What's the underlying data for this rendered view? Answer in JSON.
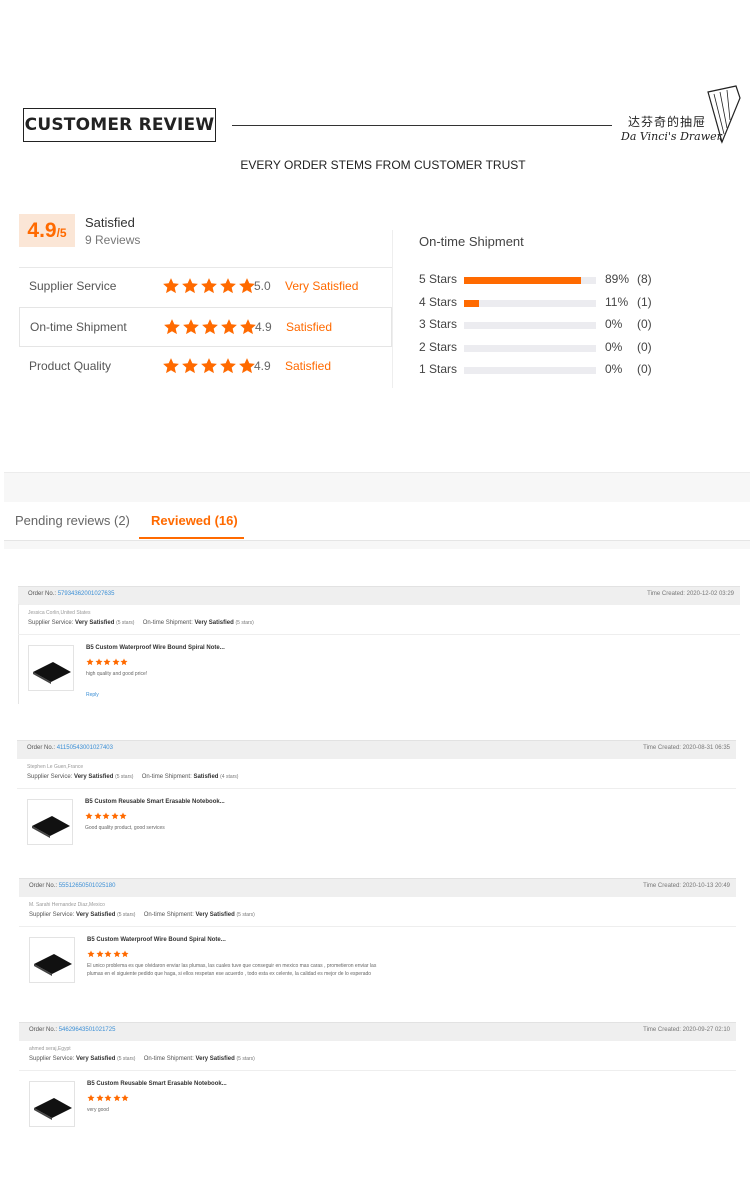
{
  "header": {
    "title": "CUSTOMER REVIEW",
    "brand_cn": "达芬奇的抽屉",
    "brand_en": "Da Vinci's Drawer",
    "subtitle": "EVERY ORDER STEMS FROM CUSTOMER TRUST"
  },
  "summary": {
    "score": "4.9",
    "score_suffix": "/5",
    "title": "Satisfied",
    "reviews": "9 Reviews",
    "rows": [
      {
        "label": "Supplier Service",
        "stars": 5,
        "score": "5.0",
        "text": "Very Satisfied"
      },
      {
        "label": "On-time Shipment",
        "stars": 5,
        "score": "4.9",
        "text": "Satisfied"
      },
      {
        "label": "Product Quality",
        "stars": 5,
        "score": "4.9",
        "text": "Satisfied"
      }
    ]
  },
  "distribution": {
    "title": "On-time Shipment",
    "rows": [
      {
        "label": "5  Stars",
        "fraction": 0.89,
        "pct": "89%",
        "count": "(8)"
      },
      {
        "label": "4  Stars",
        "fraction": 0.11,
        "pct": "11%",
        "count": "(1)"
      },
      {
        "label": "3  Stars",
        "fraction": 0,
        "pct": "0%",
        "count": "(0)"
      },
      {
        "label": "2  Stars",
        "fraction": 0,
        "pct": "0%",
        "count": "(0)"
      },
      {
        "label": "1  Stars",
        "fraction": 0,
        "pct": "0%",
        "count": "(0)"
      }
    ]
  },
  "tabs": [
    {
      "label": "Pending reviews (2)",
      "active": false
    },
    {
      "label": "Reviewed (16)",
      "active": true
    }
  ],
  "reviews": [
    {
      "order_label": "Order No.:",
      "order_no": "57934362001027635",
      "time": "Time Created: 2020-12-02 03:29",
      "user": "Jessica Corlin,United States",
      "supplier_label": "Supplier Service:",
      "supplier_value": "Very Satisfied",
      "supplier_stars": "(5 stars)",
      "shipment_label": "On-time Shipment:",
      "shipment_value": "Very Satisfied",
      "shipment_stars": "(5 stars)",
      "product": "B5 Custom Waterproof Wire Bound Spiral Note...",
      "comment": "high quality and good price!",
      "reply": "Reply"
    },
    {
      "order_label": "Order No.:",
      "order_no": "41150543001027403",
      "time": "Time Created: 2020-08-31 06:35",
      "user": "Stephen Le Guen,France",
      "supplier_label": "Supplier Service:",
      "supplier_value": "Very Satisfied",
      "supplier_stars": "(5 stars)",
      "shipment_label": "On-time Shipment:",
      "shipment_value": "Satisfied",
      "shipment_stars": "(4 stars)",
      "product": "B5 Custom Reusable Smart Erasable Notebook...",
      "comment": "Good quality product, good services",
      "reply": ""
    },
    {
      "order_label": "Order No.:",
      "order_no": "55512650501025180",
      "time": "Time Created: 2020-10-13 20:49",
      "user": "M. Sarahi Hernandez Diaz,Mexico",
      "supplier_label": "Supplier Service:",
      "supplier_value": "Very Satisfied",
      "supplier_stars": "(5 stars)",
      "shipment_label": "On-time Shipment:",
      "shipment_value": "Very Satisfied",
      "shipment_stars": "(5 stars)",
      "product": "B5 Custom Waterproof Wire Bound Spiral Note...",
      "comment": "El unico problema es que olvidaron enviar las plumas, las cuales tuve que conseguir en mexico mas caras , prometieron enviar las plumas en el siguiente pedido que haga, si ellos respetan ese acuerdo , todo esta ex celente, la calidad es mejor de lo esperado",
      "reply": ""
    },
    {
      "order_label": "Order No.:",
      "order_no": "54629643501021725",
      "time": "Time Created: 2020-09-27 02:10",
      "user": "ahmed seraj,Egypt",
      "supplier_label": "Supplier Service:",
      "supplier_value": "Very Satisfied",
      "supplier_stars": "(5 stars)",
      "shipment_label": "On-time Shipment:",
      "shipment_value": "Very Satisfied",
      "shipment_stars": "(5 stars)",
      "product": "B5 Custom Reusable Smart Erasable Notebook...",
      "comment": "very good",
      "reply": ""
    }
  ],
  "colors": {
    "accent": "#ff6a00",
    "link": "#3b8fd6",
    "track": "#ececf0"
  }
}
